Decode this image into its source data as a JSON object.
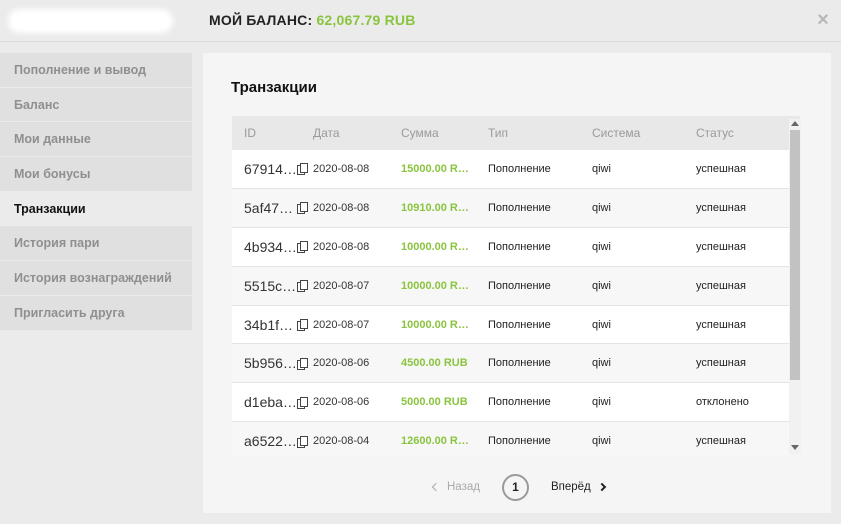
{
  "header": {
    "balance_label": "МОЙ БАЛАНС:",
    "balance_value": "62,067.79 RUB",
    "close_glyph": "×"
  },
  "sidebar": {
    "items": [
      {
        "label": "Пополнение и вывод",
        "active": false
      },
      {
        "label": "Баланс",
        "active": false
      },
      {
        "label": "Мои данные",
        "active": false
      },
      {
        "label": "Мои бонусы",
        "active": false
      },
      {
        "label": "Транзакции",
        "active": true
      },
      {
        "label": "История пари",
        "active": false
      },
      {
        "label": "История вознаграждений",
        "active": false
      },
      {
        "label": "Пригласить друга",
        "active": false
      }
    ]
  },
  "main": {
    "title": "Транзакции",
    "columns": [
      "ID",
      "Дата",
      "Сумма",
      "Тип",
      "Система",
      "Статус"
    ],
    "rows": [
      {
        "id": "67914…",
        "date": "2020-08-08",
        "amount": "15000.00 R…",
        "type": "Пополнение",
        "system": "qiwi",
        "status": "успешная"
      },
      {
        "id": "5af47…",
        "date": "2020-08-08",
        "amount": "10910.00 R…",
        "type": "Пополнение",
        "system": "qiwi",
        "status": "успешная"
      },
      {
        "id": "4b934…",
        "date": "2020-08-08",
        "amount": "10000.00 R…",
        "type": "Пополнение",
        "system": "qiwi",
        "status": "успешная"
      },
      {
        "id": "5515c…",
        "date": "2020-08-07",
        "amount": "10000.00 R…",
        "type": "Пополнение",
        "system": "qiwi",
        "status": "успешная"
      },
      {
        "id": "34b1f…",
        "date": "2020-08-07",
        "amount": "10000.00 R…",
        "type": "Пополнение",
        "system": "qiwi",
        "status": "успешная"
      },
      {
        "id": "5b956…",
        "date": "2020-08-06",
        "amount": "4500.00 RUB",
        "type": "Пополнение",
        "system": "qiwi",
        "status": "успешная"
      },
      {
        "id": "d1eba…",
        "date": "2020-08-06",
        "amount": "5000.00 RUB",
        "type": "Пополнение",
        "system": "qiwi",
        "status": "отклонено"
      },
      {
        "id": "a6522…",
        "date": "2020-08-04",
        "amount": "12600.00 R…",
        "type": "Пополнение",
        "system": "qiwi",
        "status": "успешная"
      }
    ]
  },
  "pagination": {
    "prev_label": "Назад",
    "current_page": "1",
    "next_label": "Вперёд"
  },
  "colors": {
    "accent_green": "#8ac43f",
    "background": "#ebebeb",
    "panel": "#f5f5f5"
  },
  "icons": {
    "close": "close-icon",
    "copy": "copy-icon",
    "prev": "chevron-left-icon",
    "next": "chevron-right-icon"
  }
}
